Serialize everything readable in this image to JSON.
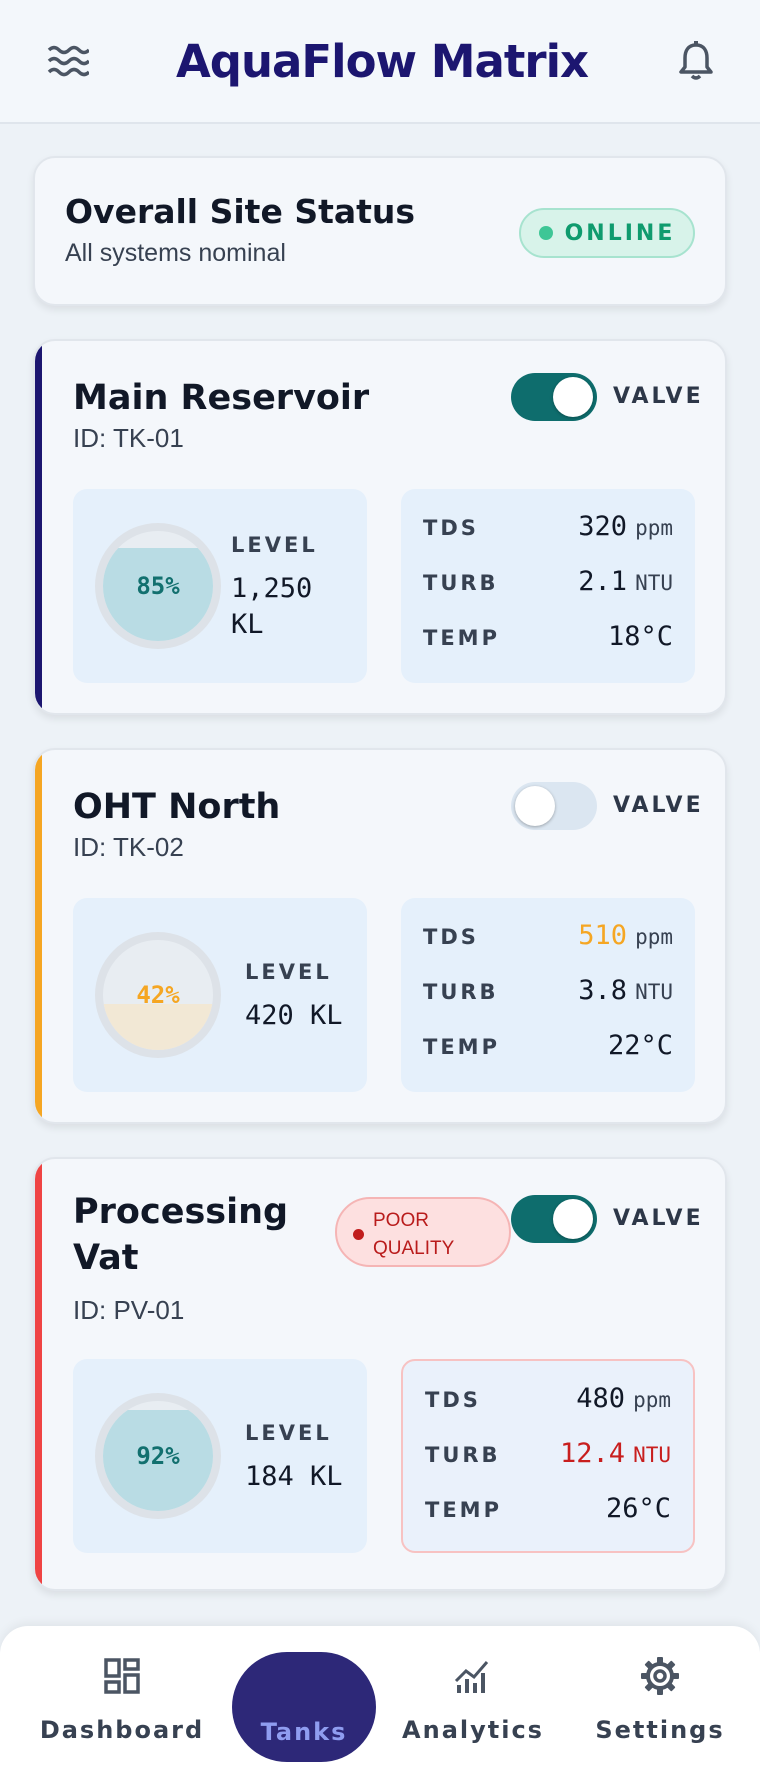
{
  "app": {
    "title": "AquaFlow Matrix"
  },
  "header": {
    "menu_icon": "waves-icon",
    "notify_icon": "bell-icon"
  },
  "site_status": {
    "title": "Overall Site Status",
    "subtitle": "All systems nominal",
    "badge": "ONLINE",
    "badge_color": "#0f9b6e"
  },
  "tanks": [
    {
      "name": "Main Reservoir",
      "id": "ID: TK-01",
      "accent_color": "#1c1670",
      "valve_on": true,
      "valve_label": "VALVE",
      "level_pct": 0.85,
      "level_pct_label": "85%",
      "level_label": "LEVEL",
      "level_value": "1,250 KL",
      "metrics": [
        {
          "label": "TDS",
          "value": "320",
          "unit": "ppm",
          "status": "normal"
        },
        {
          "label": "TURB",
          "value": "2.1",
          "unit": "NTU",
          "status": "normal"
        },
        {
          "label": "TEMP",
          "value": "18°C",
          "unit": "",
          "status": "normal"
        }
      ]
    },
    {
      "name": "OHT North",
      "id": "ID: TK-02",
      "accent_color": "#f5a623",
      "valve_on": false,
      "valve_label": "VALVE",
      "level_pct": 0.42,
      "level_pct_label": "42%",
      "level_label": "LEVEL",
      "level_value": "420 KL",
      "metrics": [
        {
          "label": "TDS",
          "value": "510",
          "unit": "ppm",
          "status": "warning"
        },
        {
          "label": "TURB",
          "value": "3.8",
          "unit": "NTU",
          "status": "normal"
        },
        {
          "label": "TEMP",
          "value": "22°C",
          "unit": "",
          "status": "normal"
        }
      ]
    },
    {
      "name_line1": "Processing",
      "name_line2": "Vat",
      "id": "ID: PV-01",
      "accent_color": "#ef4444",
      "badge_line1": "POOR",
      "badge_line2": "QUALITY",
      "valve_on": true,
      "valve_label": "VALVE",
      "level_pct": 0.92,
      "level_pct_label": "92%",
      "level_label": "LEVEL",
      "level_value": "184 KL",
      "metrics": [
        {
          "label": "TDS",
          "value": "480",
          "unit": "ppm",
          "status": "normal"
        },
        {
          "label": "TURB",
          "value": "12.4",
          "unit": "NTU",
          "status": "critical"
        },
        {
          "label": "TEMP",
          "value": "26°C",
          "unit": "",
          "status": "normal"
        }
      ]
    }
  ],
  "colors": {
    "water": "#b9dce4",
    "water_text": "#12706f",
    "sediment": "#f2e8d5",
    "warning": "#f5a623",
    "critical": "#c81e1e"
  },
  "nav": {
    "items": [
      {
        "label": "Dashboard",
        "icon": "dashboard-icon"
      },
      {
        "label": "Tanks",
        "icon": "tanks",
        "active": true
      },
      {
        "label": "Analytics",
        "icon": "analytics-icon"
      },
      {
        "label": "Settings",
        "icon": "gear-icon"
      }
    ]
  }
}
